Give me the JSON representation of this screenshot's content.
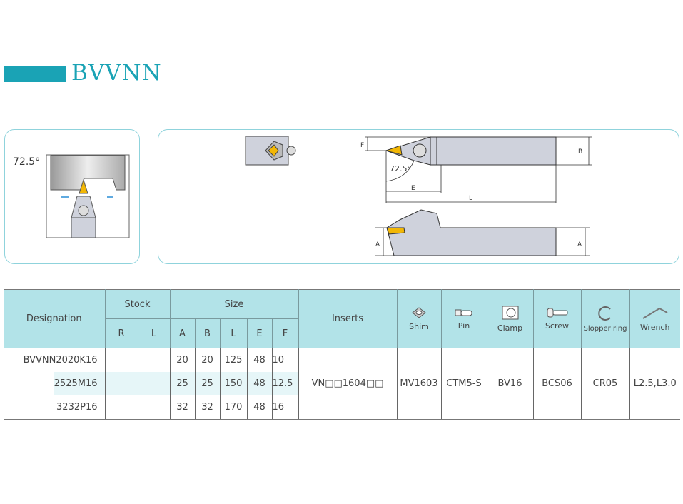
{
  "title": "BVVNN",
  "accent": "#1aa3b5",
  "header_bg": "#b2e3e8",
  "diagram": {
    "angle_label": "72.5°",
    "dims": {
      "F": "F",
      "B": "B",
      "E": "E",
      "L": "L",
      "A": "A"
    }
  },
  "table": {
    "headers": {
      "designation": "Designation",
      "stock": "Stock",
      "size": "Size",
      "inserts": "Inserts",
      "stock_cols": [
        "R",
        "L"
      ],
      "size_cols": [
        "A",
        "B",
        "L",
        "E",
        "F"
      ],
      "parts": [
        {
          "label": "Shim",
          "icon": "shim-icon"
        },
        {
          "label": "Pin",
          "icon": "pin-icon"
        },
        {
          "label": "Clamp",
          "icon": "clamp-icon"
        },
        {
          "label": "Screw",
          "icon": "screw-icon"
        },
        {
          "label": "Slopper ring",
          "icon": "ring-icon"
        },
        {
          "label": "Wrench",
          "icon": "wrench-icon"
        }
      ]
    },
    "rows": [
      {
        "designation": "BVVNN2020K16",
        "R": "",
        "L": "",
        "A": "20",
        "B": "20",
        "Ls": "125",
        "E": "48",
        "F": "10"
      },
      {
        "designation": "2525M16",
        "R": "",
        "L": "",
        "A": "25",
        "B": "25",
        "Ls": "150",
        "E": "48",
        "F": "12.5"
      },
      {
        "designation": "3232P16",
        "R": "",
        "L": "",
        "A": "32",
        "B": "32",
        "Ls": "170",
        "E": "48",
        "F": "16"
      }
    ],
    "shared": {
      "inserts": "VN□□1604□□",
      "shim": "MV1603",
      "pin": "CTM5-S",
      "clamp": "BV16",
      "screw": "BCS06",
      "ring": "CR05",
      "wrench": "L2.5,L3.0"
    }
  }
}
